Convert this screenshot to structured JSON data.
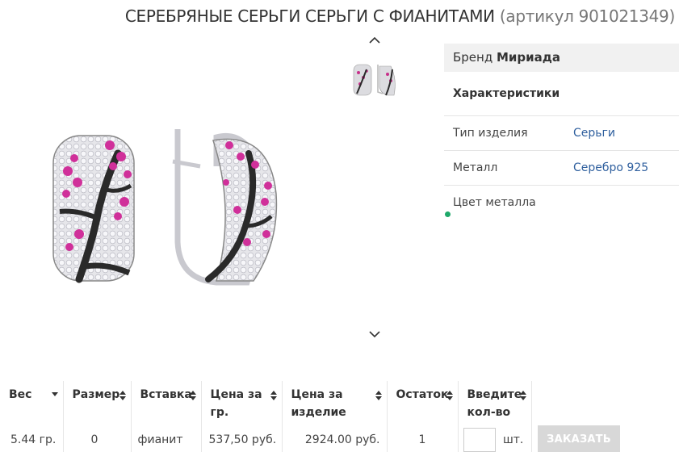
{
  "product": {
    "title": "СЕРЕБРЯНЫЕ СЕРЬГИ СЕРЬГИ С ФИАНИТАМИ",
    "sku": "(артикул 901021349)"
  },
  "gallery": {
    "up_icon": "chevron-up-icon",
    "down_icon": "chevron-down-icon"
  },
  "props": {
    "brand_label": "Бренд",
    "brand_value": "Мириада",
    "char_heading": "Характеристики",
    "rows": [
      {
        "key": "Тип изделия",
        "value": "Серьги"
      },
      {
        "key": "Металл",
        "value": "Серебро 925"
      },
      {
        "key": "Цвет металла",
        "value": ""
      }
    ]
  },
  "table": {
    "headers": [
      "Вес",
      "Размер",
      "Вставка",
      "Цена за гр.",
      "Цена за изделие",
      "Остаток",
      "Введите кол-во"
    ],
    "header_lines": [
      [
        "Вес"
      ],
      [
        "Размер"
      ],
      [
        "Вставка"
      ],
      [
        "Цена за",
        "гр."
      ],
      [
        "Цена за",
        "изделие"
      ],
      [
        "Остаток"
      ],
      [
        "Введите",
        "кол-во"
      ]
    ],
    "row": {
      "weight": "5.44 гр.",
      "size": "0",
      "insert": "фианит",
      "price_per_gram": "537,50 руб.",
      "price_item": "2924.00 руб.",
      "stock": "1",
      "qty_value": "",
      "qty_unit": "шт."
    },
    "order_button": "ЗАКАЗАТЬ"
  },
  "colors": {
    "link": "#2f5f9e",
    "brand_bg": "#f1f1f1",
    "button_bg": "#d8d8d8",
    "dot": "#1ea86a"
  }
}
